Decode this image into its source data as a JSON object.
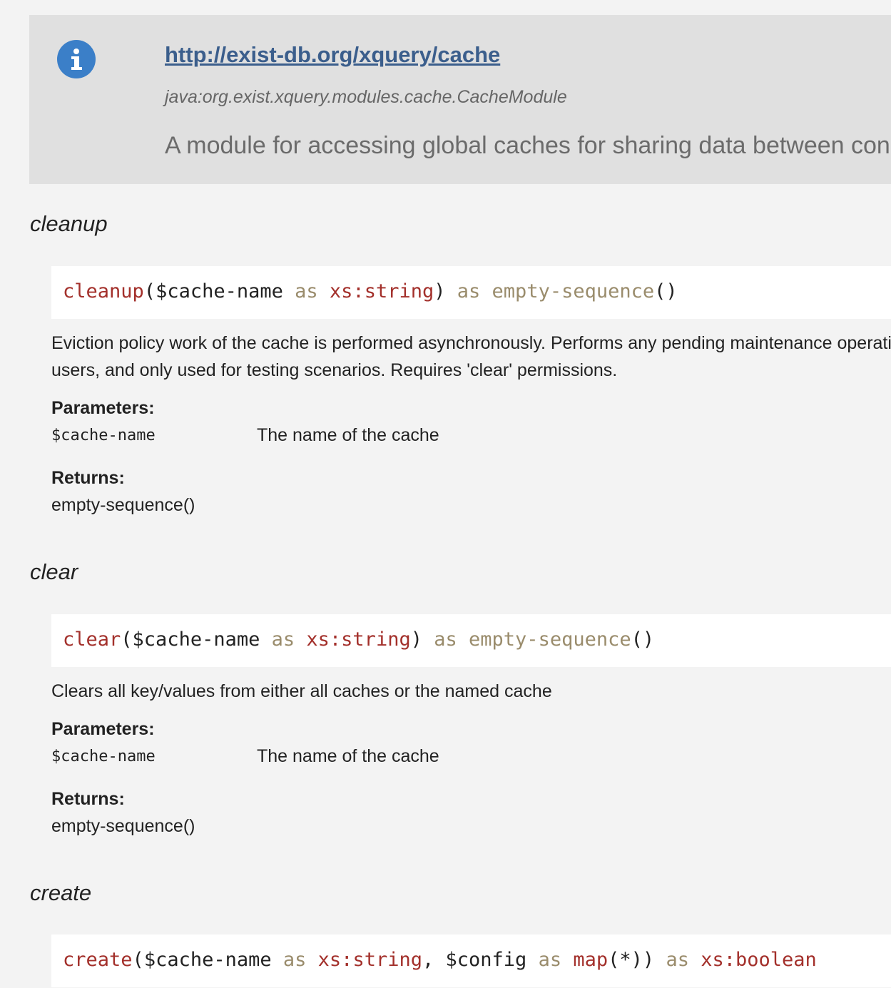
{
  "module": {
    "icon": "info-icon",
    "uri": "http://exist-db.org/xquery/cache",
    "java_class": "java:org.exist.xquery.modules.cache.CacheModule",
    "description": "A module for accessing global caches for sharing data between concurrent sessions"
  },
  "functions": [
    {
      "name": "cleanup",
      "signature": {
        "fn": "cleanup",
        "open": "(",
        "p1_var": "$cache-name",
        "p1_as": "as",
        "p1_type": "xs:string",
        "close": ")",
        "ret_as": "as",
        "ret_type": "empty-sequence",
        "ret_parens": "()"
      },
      "description_lines": [
        "Eviction policy work of the cache is performed asynchronously. Performs any pending maintenance operations",
        "users, and only used for testing scenarios. Requires 'clear' permissions."
      ],
      "parameters_label": "Parameters:",
      "parameters": [
        {
          "name": "$cache-name",
          "description": "The name of the cache"
        }
      ],
      "returns_label": "Returns:",
      "returns": "empty-sequence()"
    },
    {
      "name": "clear",
      "signature": {
        "fn": "clear",
        "open": "(",
        "p1_var": "$cache-name",
        "p1_as": "as",
        "p1_type": "xs:string",
        "close": ")",
        "ret_as": "as",
        "ret_type": "empty-sequence",
        "ret_parens": "()"
      },
      "description_lines": [
        "Clears all key/values from either all caches or the named cache"
      ],
      "parameters_label": "Parameters:",
      "parameters": [
        {
          "name": "$cache-name",
          "description": "The name of the cache"
        }
      ],
      "returns_label": "Returns:",
      "returns": "empty-sequence()"
    },
    {
      "name": "create",
      "signature": {
        "fn": "create",
        "open": "(",
        "p1_var": "$cache-name",
        "p1_as": "as",
        "p1_type": "xs:string",
        "sep": ", ",
        "p2_var": "$config",
        "p2_as": "as",
        "p2_type": "map",
        "p2_parens": "(*)",
        "close": ")",
        "ret_as": "as",
        "ret_type": "xs:boolean"
      }
    }
  ],
  "colors": {
    "function_name": "#a3302b",
    "keyword": "#9a8c6c",
    "type": "#a3302b",
    "link": "#3b5e8c",
    "info_icon_bg": "#3b7fc8"
  }
}
